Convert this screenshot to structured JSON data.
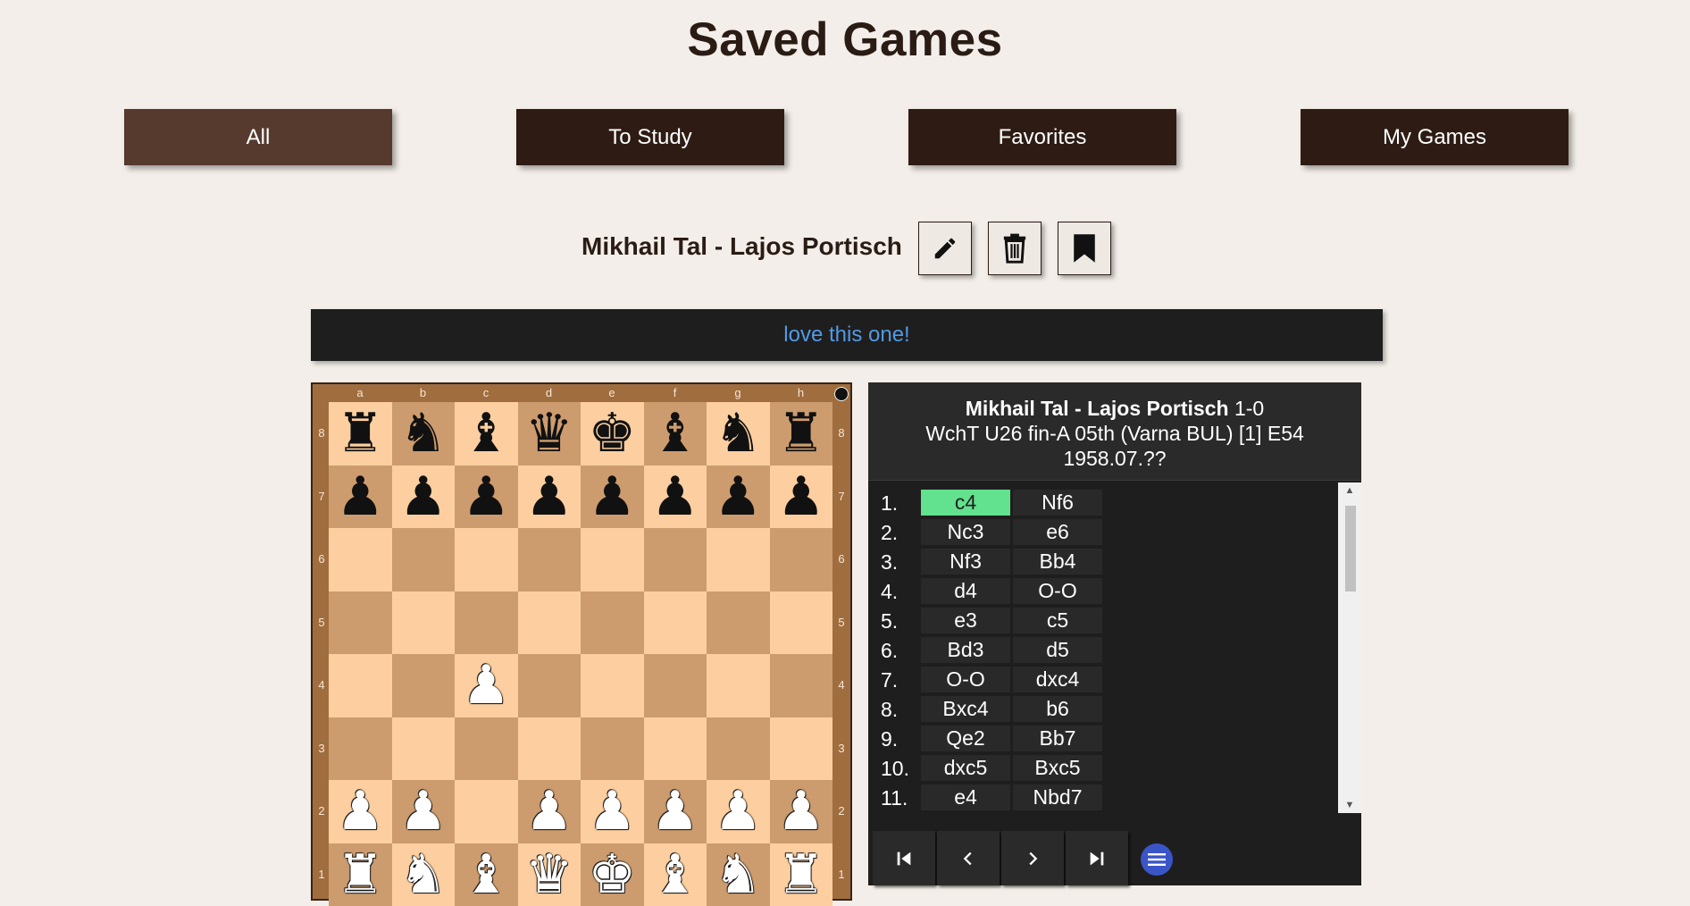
{
  "page": {
    "title": "Saved Games"
  },
  "tabs": [
    {
      "label": "All",
      "active": true
    },
    {
      "label": "To Study",
      "active": false
    },
    {
      "label": "Favorites",
      "active": false
    },
    {
      "label": "My Games",
      "active": false
    }
  ],
  "game": {
    "title": "Mikhail Tal - Lajos Portisch",
    "actions": [
      "pencil-icon",
      "trash-icon",
      "bookmark-icon"
    ],
    "note": "love this one!"
  },
  "board": {
    "files": [
      "a",
      "b",
      "c",
      "d",
      "e",
      "f",
      "g",
      "h"
    ],
    "ranks": [
      "8",
      "7",
      "6",
      "5",
      "4",
      "3",
      "2",
      "1"
    ],
    "position": [
      [
        "bR",
        "bN",
        "bB",
        "bQ",
        "bK",
        "bB",
        "bN",
        "bR"
      ],
      [
        "bP",
        "bP",
        "bP",
        "bP",
        "bP",
        "bP",
        "bP",
        "bP"
      ],
      [
        "",
        "",
        "",
        "",
        "",
        "",
        "",
        ""
      ],
      [
        "",
        "",
        "",
        "",
        "",
        "",
        "",
        ""
      ],
      [
        "",
        "",
        "wP",
        "",
        "",
        "",
        "",
        ""
      ],
      [
        "",
        "",
        "",
        "",
        "",
        "",
        "",
        ""
      ],
      [
        "wP",
        "wP",
        "",
        "wP",
        "wP",
        "wP",
        "wP",
        "wP"
      ],
      [
        "wR",
        "wN",
        "wB",
        "wQ",
        "wK",
        "wB",
        "wN",
        "wR"
      ]
    ],
    "side_to_move": "black"
  },
  "info": {
    "players": "Mikhail Tal - Lajos Portisch",
    "result": "1-0",
    "event": "WchT U26 fin-A 05th (Varna BUL) [1] E54",
    "date": "1958.07.??"
  },
  "moves": [
    {
      "num": "1.",
      "white": "c4",
      "black": "Nf6"
    },
    {
      "num": "2.",
      "white": "Nc3",
      "black": "e6"
    },
    {
      "num": "3.",
      "white": "Nf3",
      "black": "Bb4"
    },
    {
      "num": "4.",
      "white": "d4",
      "black": "O-O"
    },
    {
      "num": "5.",
      "white": "e3",
      "black": "c5"
    },
    {
      "num": "6.",
      "white": "Bd3",
      "black": "d5"
    },
    {
      "num": "7.",
      "white": "O-O",
      "black": "dxc4"
    },
    {
      "num": "8.",
      "white": "Bxc4",
      "black": "b6"
    },
    {
      "num": "9.",
      "white": "Qe2",
      "black": "Bb7"
    },
    {
      "num": "10.",
      "white": "dxc5",
      "black": "Bxc5"
    },
    {
      "num": "11.",
      "white": "e4",
      "black": "Nbd7"
    }
  ],
  "current_move": "1. c4",
  "nav": [
    "first-move-icon",
    "previous-move-icon",
    "next-move-icon",
    "last-move-icon",
    "menu-icon"
  ],
  "colors": {
    "background": "#f3eee9",
    "tab": "#2e1c14",
    "tab_active": "#563a2e",
    "note_text": "#4f9be6",
    "current_move": "#62e28e",
    "board_light": "#fdcfa0",
    "board_dark": "#cd9c6e"
  }
}
